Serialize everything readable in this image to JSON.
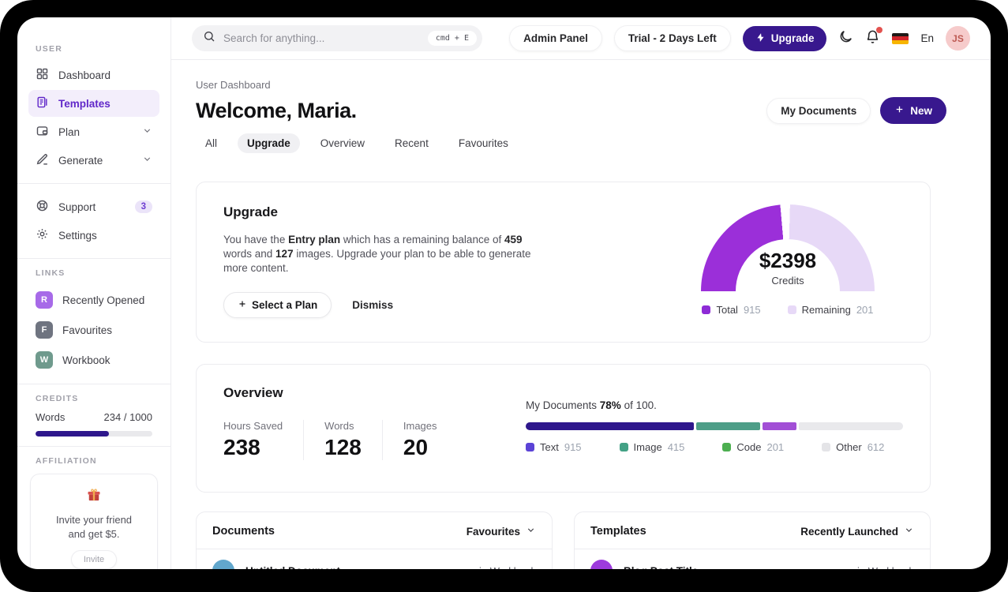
{
  "theme": {
    "accent_indigo": "#38188e",
    "accent_purple": "#9b2fd9",
    "accent_lavender": "#e7d9f7",
    "notification_red": "#e3524f"
  },
  "sidebar": {
    "section_user": "USER",
    "nav": [
      {
        "label": "Dashboard",
        "active": false
      },
      {
        "label": "Templates",
        "active": true
      },
      {
        "label": "Plan",
        "active": false
      },
      {
        "label": "Generate",
        "active": false
      }
    ],
    "support": {
      "label": "Support",
      "badge": "3"
    },
    "settings_label": "Settings",
    "section_links": "LINKS",
    "links": [
      {
        "initial": "R",
        "label": "Recently Opened",
        "color": "#a76ae8"
      },
      {
        "initial": "F",
        "label": "Favourites",
        "color": "#6f7480"
      },
      {
        "initial": "W",
        "label": "Workbook",
        "color": "#6f9a8d"
      }
    ],
    "section_credits": "CREDITS",
    "credits": {
      "label": "Words",
      "value": "234 / 1000",
      "bar_width": "63%",
      "bar_color": "#2e178c"
    },
    "section_affiliation": "AFFILIATION",
    "affiliation": {
      "text": "Invite your friend and get $5.",
      "button_label": "Invite"
    }
  },
  "topbar": {
    "search": {
      "placeholder": "Search for anything...",
      "shortcut": "cmd + E"
    },
    "admin_panel_label": "Admin Panel",
    "trial_label": "Trial - 2 Days Left",
    "upgrade_label": "Upgrade",
    "language_label": "En",
    "avatar_initials": "JS"
  },
  "header": {
    "breadcrumb": "User Dashboard",
    "title": "Welcome, Maria.",
    "my_documents_label": "My Documents",
    "new_label": "New",
    "tabs": [
      {
        "label": "All",
        "active": false
      },
      {
        "label": "Upgrade",
        "active": true
      },
      {
        "label": "Overview",
        "active": false
      },
      {
        "label": "Recent",
        "active": false
      },
      {
        "label": "Favourites",
        "active": false
      }
    ]
  },
  "upgrade_card": {
    "title": "Upgrade",
    "body": {
      "t1": "You have the ",
      "b1": "Entry plan",
      "t2": " which has a remaining balance of ",
      "b2": "459",
      "t3": " words and ",
      "b3": "127",
      "t4": " images. Upgrade your plan to be able to generate more content."
    },
    "select_plan_label": "Select a Plan",
    "dismiss_label": "Dismiss",
    "gauge": {
      "type": "donut-semicircle",
      "center_value": "$2398",
      "center_label": "Credits",
      "legend": [
        {
          "label": "Total",
          "value": "915",
          "color": "#8e2bd6"
        },
        {
          "label": "Remaining",
          "value": "201",
          "color": "#e7d9f7"
        }
      ]
    }
  },
  "overview_card": {
    "title": "Overview",
    "stats": [
      {
        "label": "Hours Saved",
        "value": "238"
      },
      {
        "label": "Words",
        "value": "128"
      },
      {
        "label": "Images",
        "value": "20"
      }
    ],
    "progress_line": {
      "prefix": "My Documents ",
      "percent": "78%",
      "suffix": " of 100."
    },
    "bar": {
      "type": "stacked-bar",
      "segments": [
        {
          "name": "Text",
          "width": "44.5%",
          "color": "#2e178c"
        },
        {
          "name": "Image",
          "width": "17%",
          "color": "#4e9e88"
        },
        {
          "name": "Code",
          "width": "9%",
          "color": "#a24fd6"
        },
        {
          "name": "Other",
          "width": "29.5%",
          "color": "#e9e9ec"
        }
      ]
    },
    "legend": [
      {
        "label": "Text",
        "value": "915",
        "color": "#5b43d6"
      },
      {
        "label": "Image",
        "value": "415",
        "color": "#43a185"
      },
      {
        "label": "Code",
        "value": "201",
        "color": "#4caf50"
      },
      {
        "label": "Other",
        "value": "612",
        "color": "#e4e4e7"
      }
    ]
  },
  "documents_card": {
    "title": "Documents",
    "filter_label": "Favourites",
    "rows": [
      {
        "title": "Untitled Document",
        "location": "in Workbook",
        "avatar_color": "#62a7cc"
      }
    ]
  },
  "templates_card": {
    "title": "Templates",
    "filter_label": "Recently Launched",
    "rows": [
      {
        "title": "Blog Post Title",
        "location": "in Workbook",
        "avatar_color": "#9d3bdd"
      }
    ]
  }
}
